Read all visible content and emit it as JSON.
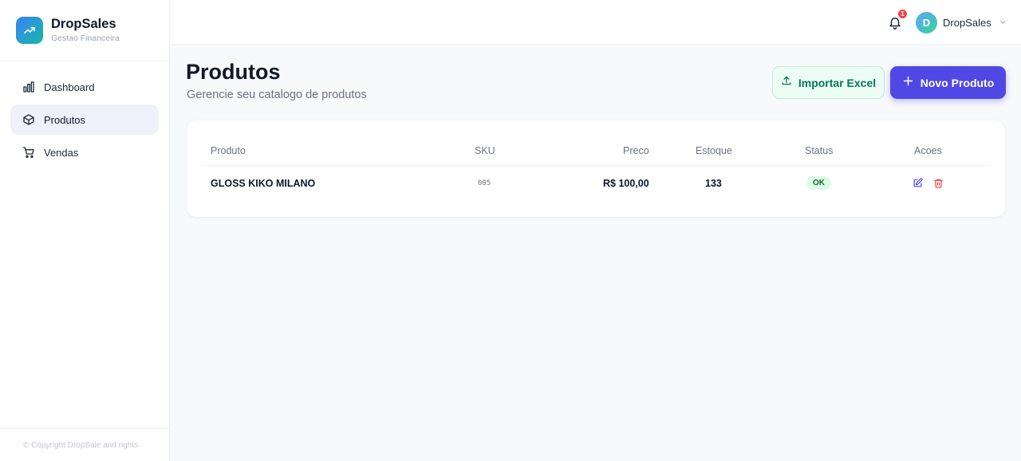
{
  "brand": {
    "name": "DropSales",
    "subtitle": "Gestao Financeira"
  },
  "sidebar": {
    "items": [
      {
        "label": "Dashboard",
        "icon": "bar-chart-icon",
        "active": false
      },
      {
        "label": "Produtos",
        "icon": "box-icon",
        "active": true
      },
      {
        "label": "Vendas",
        "icon": "cart-icon",
        "active": false
      }
    ],
    "footer": "© Copyright DropSale and rights"
  },
  "topbar": {
    "notification_count": "1",
    "user": {
      "initial": "D",
      "name": "DropSales"
    }
  },
  "page": {
    "title": "Produtos",
    "subtitle": "Gerencie seu catalogo de produtos",
    "import_label": "Importar Excel",
    "new_label": "Novo Produto"
  },
  "table": {
    "headers": {
      "produto": "Produto",
      "sku": "SKU",
      "preco": "Preco",
      "estoque": "Estoque",
      "status": "Status",
      "acoes": "Acoes"
    },
    "rows": [
      {
        "produto": "GLOSS KIKO MILANO",
        "sku": "005",
        "preco": "R$ 100,00",
        "estoque": "133",
        "status": "OK"
      }
    ]
  },
  "colors": {
    "primary": "#5048e5",
    "import_bg": "#ecfdf5",
    "import_text": "#047857",
    "status_ok_bg": "#dcfce7",
    "status_ok_text": "#166534",
    "badge": "#ef4444"
  }
}
